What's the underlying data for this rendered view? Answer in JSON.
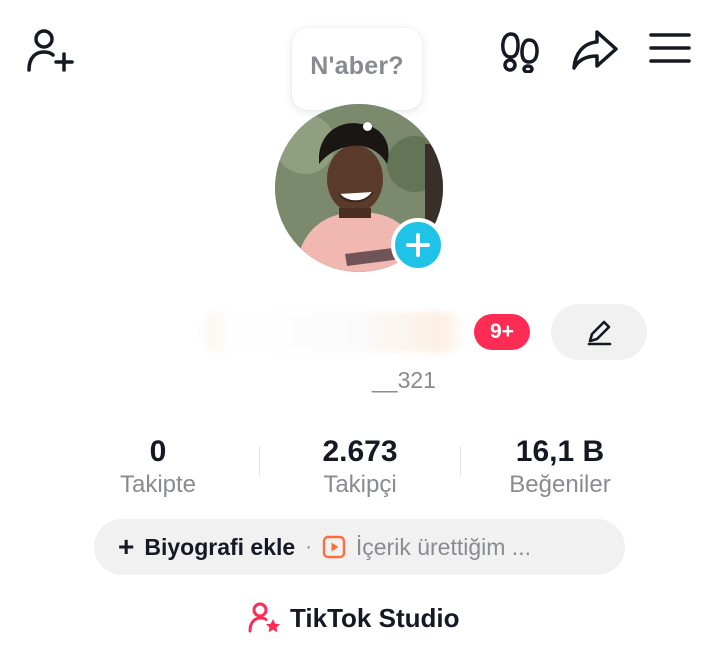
{
  "top_bar": {
    "add_friend_icon": "person-plus-icon",
    "footprints_icon": "footprints-icon",
    "share_icon": "share-arrow-icon",
    "menu_icon": "hamburger-menu-icon"
  },
  "bubble": {
    "text": "N'aber?"
  },
  "avatar": {
    "add_icon": "plus-icon",
    "accent": "#20c3e8"
  },
  "profile": {
    "notification_badge": "9+",
    "badge_color": "#fe2c55",
    "edit_icon": "pencil-icon",
    "username": "__321"
  },
  "stats": [
    {
      "value": "0",
      "label": "Takipte"
    },
    {
      "value": "2.673",
      "label": "Takipçi"
    },
    {
      "value": "16,1 B",
      "label": "Beğeniler"
    }
  ],
  "bio": {
    "add_label": "Biyografi ekle",
    "separator": "·",
    "content_icon": "video-play-icon",
    "content_text": "İçerik ürettiğim ...",
    "content_color": "#ff6d3f"
  },
  "studio": {
    "icon": "person-star-icon",
    "label": "TikTok Studio",
    "icon_color": "#fe2c55"
  }
}
